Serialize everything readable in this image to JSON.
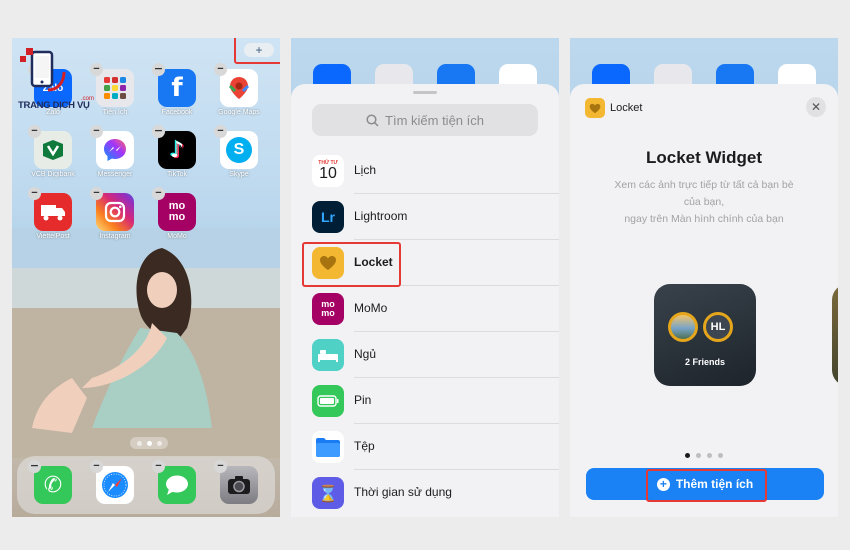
{
  "logo": {
    "text": "TRANG DỊCH VỤ",
    "suffix": ".com"
  },
  "home": {
    "apps": [
      {
        "label": "Zalo",
        "icon": "zalo-icon",
        "color": "#0a68ff",
        "glyph": "Zalo"
      },
      {
        "label": "Tiện ích",
        "icon": "utilities-folder-icon",
        "color": "#e8e8ec",
        "glyph": ""
      },
      {
        "label": "Facebook",
        "icon": "facebook-icon",
        "color": "#1877f2",
        "glyph": "f"
      },
      {
        "label": "Google Maps",
        "icon": "google-maps-icon",
        "color": "#ffffff",
        "glyph": ""
      },
      {
        "label": "VCB Digibank",
        "icon": "vcb-digibank-icon",
        "color": "#e8ece6",
        "glyph": ""
      },
      {
        "label": "Messenger",
        "icon": "messenger-icon",
        "color": "#ffffff",
        "glyph": ""
      },
      {
        "label": "TikTok",
        "icon": "tiktok-icon",
        "color": "#000000",
        "glyph": "♪"
      },
      {
        "label": "Skype",
        "icon": "skype-icon",
        "color": "#ffffff",
        "glyph": "S"
      },
      {
        "label": "ViettelPost",
        "icon": "viettelpost-icon",
        "color": "#e52b2b",
        "glyph": ""
      },
      {
        "label": "Instagram",
        "icon": "instagram-icon",
        "color": "#d6336c",
        "glyph": ""
      },
      {
        "label": "MoMo",
        "icon": "momo-icon",
        "color": "#a50064",
        "glyph": "mo mo"
      }
    ],
    "dock": [
      {
        "icon": "phone-icon",
        "color": "#34c759",
        "glyph": "✆"
      },
      {
        "icon": "safari-icon",
        "color": "#ffffff",
        "glyph": ""
      },
      {
        "icon": "messages-icon",
        "color": "#34c759",
        "glyph": ""
      },
      {
        "icon": "camera-icon",
        "color": "#8e8e93",
        "glyph": ""
      }
    ],
    "add_button": "+"
  },
  "widget_picker": {
    "search_placeholder": "Tìm kiếm tiện ích",
    "items": [
      {
        "label": "Lịch",
        "icon": "calendar-icon",
        "color": "#ffffff",
        "day_label": "THỨ TƯ",
        "day_number": "10"
      },
      {
        "label": "Lightroom",
        "icon": "lightroom-icon",
        "color": "#001e36",
        "glyph": "Lr"
      },
      {
        "label": "Locket",
        "icon": "locket-heart-icon",
        "color": "#f3b731",
        "glyph": ""
      },
      {
        "label": "MoMo",
        "icon": "momo-icon",
        "color": "#a50064",
        "glyph": "mo mo"
      },
      {
        "label": "Ngủ",
        "icon": "sleep-bed-icon",
        "color": "#4fd1c5",
        "glyph": ""
      },
      {
        "label": "Pin",
        "icon": "battery-icon",
        "color": "#34c759",
        "glyph": ""
      },
      {
        "label": "Tệp",
        "icon": "files-folder-icon",
        "color": "#1a7cf4",
        "glyph": ""
      },
      {
        "label": "Thời gian sử dụng",
        "icon": "screen-time-hourglass-icon",
        "color": "#5e5ce6",
        "glyph": "⌛"
      }
    ]
  },
  "widget_detail": {
    "app_name": "Locket",
    "title": "Locket Widget",
    "description_lines": [
      "Xem các ảnh trực tiếp từ tất cả bạn bè",
      "của bạn,",
      "ngay trên Màn hình chính của bạn"
    ],
    "preview": {
      "avatar_initials": "HL",
      "caption": "2 Friends"
    },
    "page_count": 4,
    "active_page": 1,
    "add_button": "Thêm tiện ích",
    "close_glyph": "✕"
  },
  "colors": {
    "highlight": "#e53935",
    "accent": "#1a82f5"
  }
}
